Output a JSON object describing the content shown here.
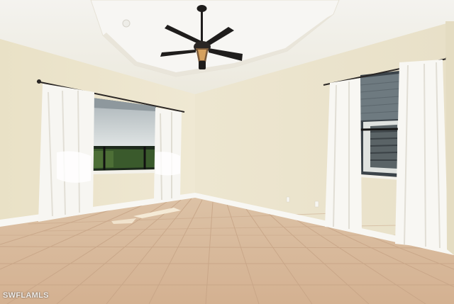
{
  "photo": {
    "subject": "empty-room-with-ceiling-fan",
    "colors": {
      "wall": "#ece6cf",
      "ceiling": "#f3f1ea",
      "floor_tile": "#d8b79a",
      "grout": "#c9a587",
      "baseboard": "#f7f6f2",
      "curtain": "#f6f5f1",
      "fan": "#1f1d1c"
    }
  },
  "watermark": {
    "text": "SWFLAMLS"
  }
}
